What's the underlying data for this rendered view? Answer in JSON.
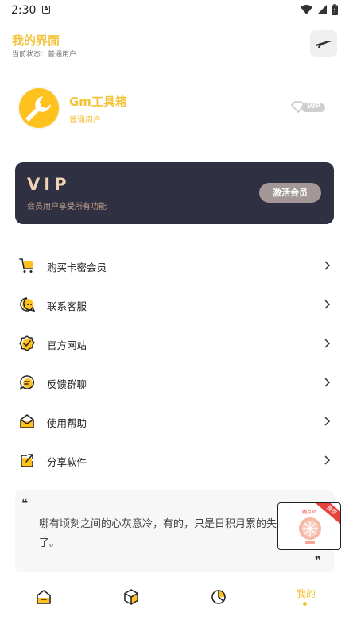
{
  "status_bar": {
    "time": "2:30",
    "notification_icon": "A"
  },
  "header": {
    "title": "我的界面",
    "subtitle": "当前状态：普通用户"
  },
  "profile": {
    "name": "Gm工具箱",
    "role": "普通用户",
    "badge": "VIP"
  },
  "vip_card": {
    "title": "VIP",
    "desc": "会员用户享受所有功能",
    "button": "激活会员"
  },
  "menu": [
    {
      "label": "购买卡密会员",
      "icon": "cart-icon"
    },
    {
      "label": "联系客服",
      "icon": "chat-icon"
    },
    {
      "label": "官方网站",
      "icon": "badge-check-icon"
    },
    {
      "label": "反馈群聊",
      "icon": "message-icon"
    },
    {
      "label": "使用帮助",
      "icon": "mail-help-icon"
    },
    {
      "label": "分享软件",
      "icon": "share-icon"
    }
  ],
  "quote": {
    "open": "❝",
    "text": "哪有顷刻之间的心灰意冷，有的，只是日积月累的失望罢了。",
    "close": "❞"
  },
  "ad": {
    "label": "随点贝",
    "tag": "推荐"
  },
  "tabbar": {
    "active_label": "我的"
  },
  "colors": {
    "accent": "#f3c33a",
    "vip_card": "#2f3041",
    "vip_gold": "#f1d2b4"
  }
}
